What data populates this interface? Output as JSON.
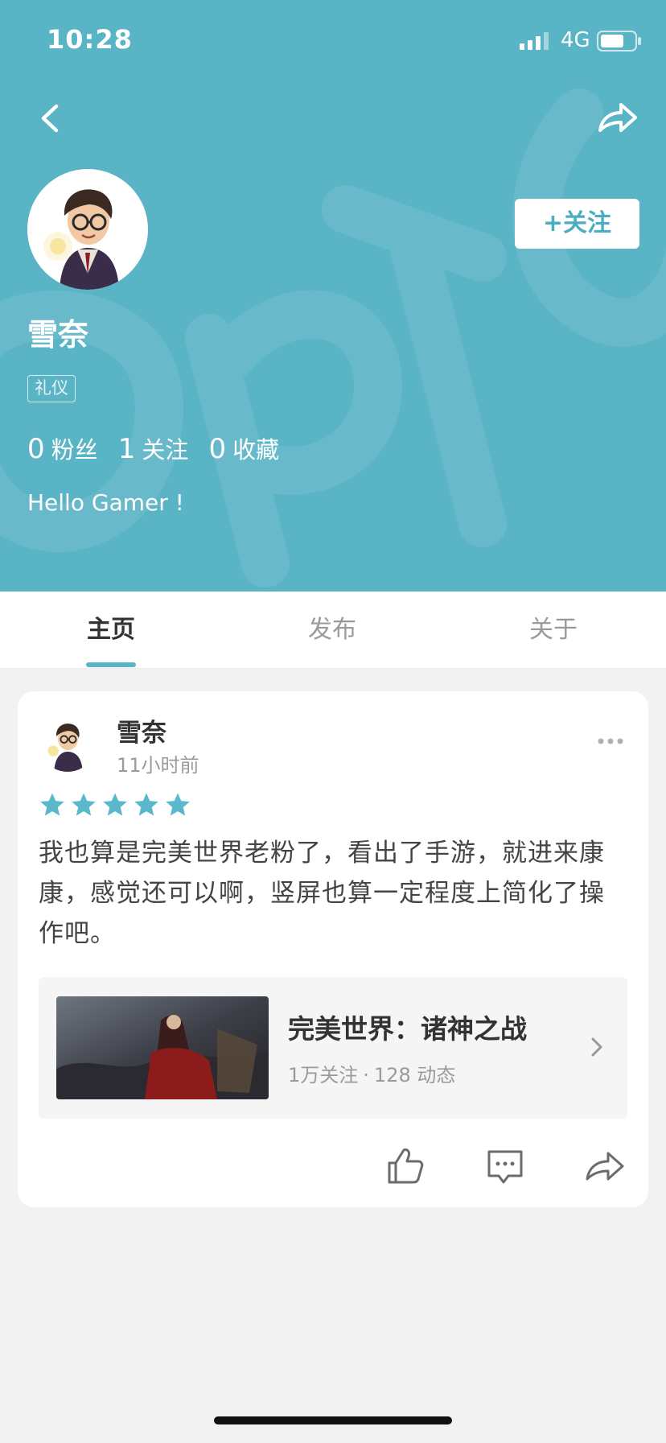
{
  "status_bar": {
    "time": "10:28",
    "network": "4G"
  },
  "profile": {
    "username": "雪奈",
    "tag": "礼仪",
    "follow_label": "+关注",
    "stats": [
      {
        "value": "0",
        "label": "粉丝"
      },
      {
        "value": "1",
        "label": "关注"
      },
      {
        "value": "0",
        "label": "收藏"
      }
    ],
    "bio": "Hello Gamer !"
  },
  "tabs": [
    {
      "label": "主页",
      "active": true
    },
    {
      "label": "发布",
      "active": false
    },
    {
      "label": "关于",
      "active": false
    }
  ],
  "post": {
    "username": "雪奈",
    "time": "11小时前",
    "rating": 5,
    "rating_max": 5,
    "text": "我也算是完美世界老粉了，看出了手游，就进来康康，感觉还可以啊，竖屏也算一定程度上简化了操作吧。",
    "game": {
      "title": "完美世界：诸神之战",
      "followers": "1万关注",
      "separator": "·",
      "posts": "128 动态"
    },
    "actions": [
      "thumbs-up-icon",
      "comment-icon",
      "share-icon"
    ]
  },
  "colors": {
    "header_bg": "#59b4c6",
    "accent": "#4aaec3",
    "star": "#5ab8cc",
    "page_bg": "#f2f2f2"
  }
}
